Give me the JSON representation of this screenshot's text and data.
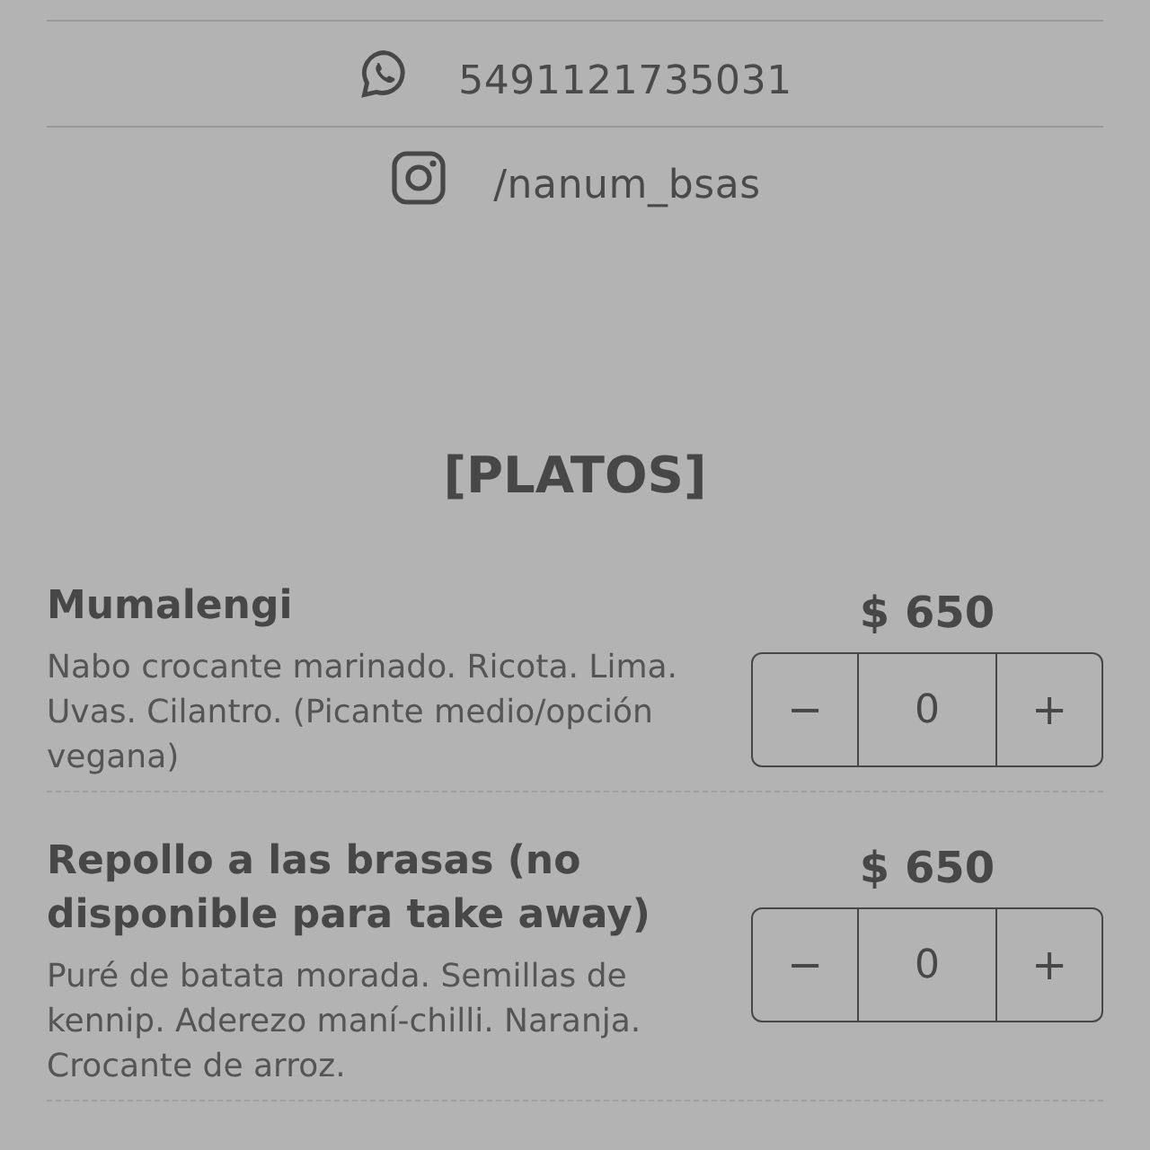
{
  "contacts": [
    {
      "kind": "whatsapp",
      "text": "5491121735031"
    },
    {
      "kind": "instagram",
      "text": "/nanum_bsas"
    }
  ],
  "section_title": "[PLATOS]",
  "dishes": [
    {
      "name": "Mumalengi",
      "description": "Nabo crocante marinado. Ricota. Lima. Uvas. Cilantro. (Picante medio/opción vegana)",
      "price": "$ 650",
      "minus": "−",
      "quantity": "0",
      "plus": "+"
    },
    {
      "name": "Repollo a las brasas (no disponible para take away)",
      "description": "Puré de batata morada. Semillas de kennip. Aderezo maní-chilli. Naranja. Crocante de arroz.",
      "price": "$ 650",
      "minus": "−",
      "quantity": "0",
      "plus": "+"
    }
  ]
}
